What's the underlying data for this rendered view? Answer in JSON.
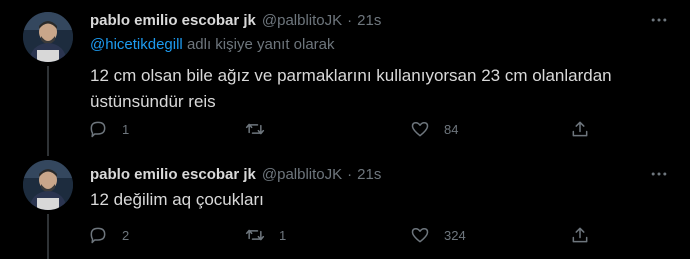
{
  "tweets": [
    {
      "name": "pablo emilio escobar jk",
      "handle": "@palblitoJK",
      "dot": "·",
      "time": "21s",
      "reply_prefix": "",
      "reply_mention": "@hicetikdegill",
      "reply_suffix": " adlı kişiye yanıt olarak",
      "text_line1": "12 cm olsan bile ağız ve parmaklarını kullanıyorsan 23 cm olanlardan",
      "text_line2": "üstünsündür reis",
      "reply_count": "1",
      "retweet_count": "",
      "like_count": "84"
    },
    {
      "name": "pablo emilio escobar jk",
      "handle": "@palblitoJK",
      "dot": "·",
      "time": "21s",
      "text_line1": "12 değilim aq çocukları",
      "reply_count": "2",
      "retweet_count": "1",
      "like_count": "324"
    }
  ],
  "icons": {
    "more": "more-horizontal-icon",
    "reply": "speech-bubble-icon",
    "retweet": "retweet-arrows-icon",
    "like": "heart-icon",
    "share": "share-upload-icon"
  },
  "colors": {
    "background": "#000000",
    "text": "#d9d9d9",
    "secondary": "#6e767d",
    "link": "#1d9bf0",
    "thread_line": "#2f3336"
  }
}
